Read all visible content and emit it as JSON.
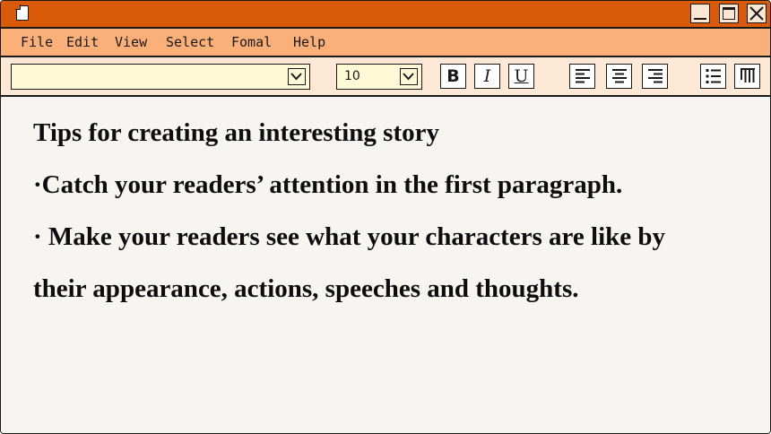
{
  "menu": {
    "items": [
      {
        "label": "File"
      },
      {
        "label": "Edit"
      },
      {
        "label": "View"
      },
      {
        "label": "Select"
      },
      {
        "label": "Fomal"
      },
      {
        "label": "Help"
      }
    ]
  },
  "toolbar": {
    "font_value": "",
    "font_size": "10",
    "bold_label": "B",
    "italic_label": "I",
    "underline_label": "U"
  },
  "document": {
    "title": "Tips for creating an interesting story",
    "lines": [
      "·Catch your readers’ attention in the first paragraph.",
      "· Make your readers see what your characters are like by",
      "their appearance, actions, speeches and thoughts."
    ]
  },
  "colors": {
    "titlebar": "#d95a09",
    "menubar": "#fbb07a",
    "toolbar": "#fde8d6",
    "content": "#f7f5f2"
  },
  "icons": [
    "document-icon",
    "minimize-icon",
    "maximize-icon",
    "close-icon",
    "chevron-down-icon",
    "align-left-icon",
    "align-center-icon",
    "align-right-icon",
    "bulleted-list-icon",
    "columns-icon"
  ]
}
